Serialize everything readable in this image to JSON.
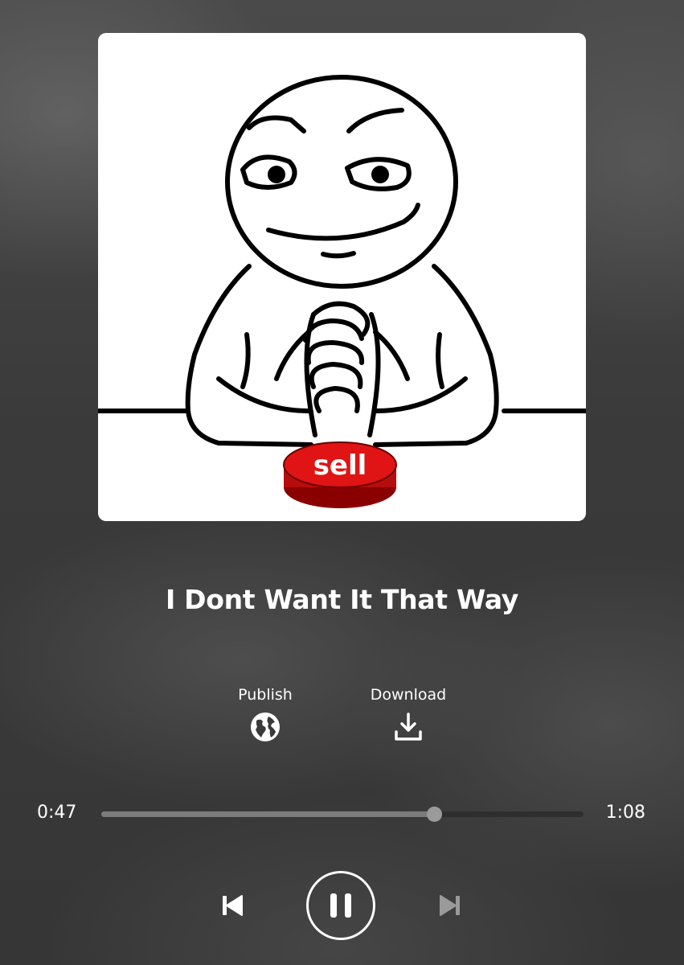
{
  "player": {
    "track_title": "I Dont Want It That Way",
    "artwork": {
      "description_icon": "smirking-meme-face-icon",
      "button_text": "sell",
      "button_color": "#e01414"
    }
  },
  "actions": {
    "publish_label": "Publish",
    "publish_icon": "globe-icon",
    "download_label": "Download",
    "download_icon": "download-icon"
  },
  "progress": {
    "elapsed": "0:47",
    "total": "1:08",
    "fraction": 0.69
  },
  "controls": {
    "prev_icon": "skip-previous-icon",
    "pause_icon": "pause-icon",
    "next_icon": "skip-next-icon"
  },
  "colors": {
    "text": "#ffffff",
    "progress_fill": "#7c7c7c",
    "progress_track": "#2e2e2e",
    "next_disabled": "#9a9a9a"
  }
}
